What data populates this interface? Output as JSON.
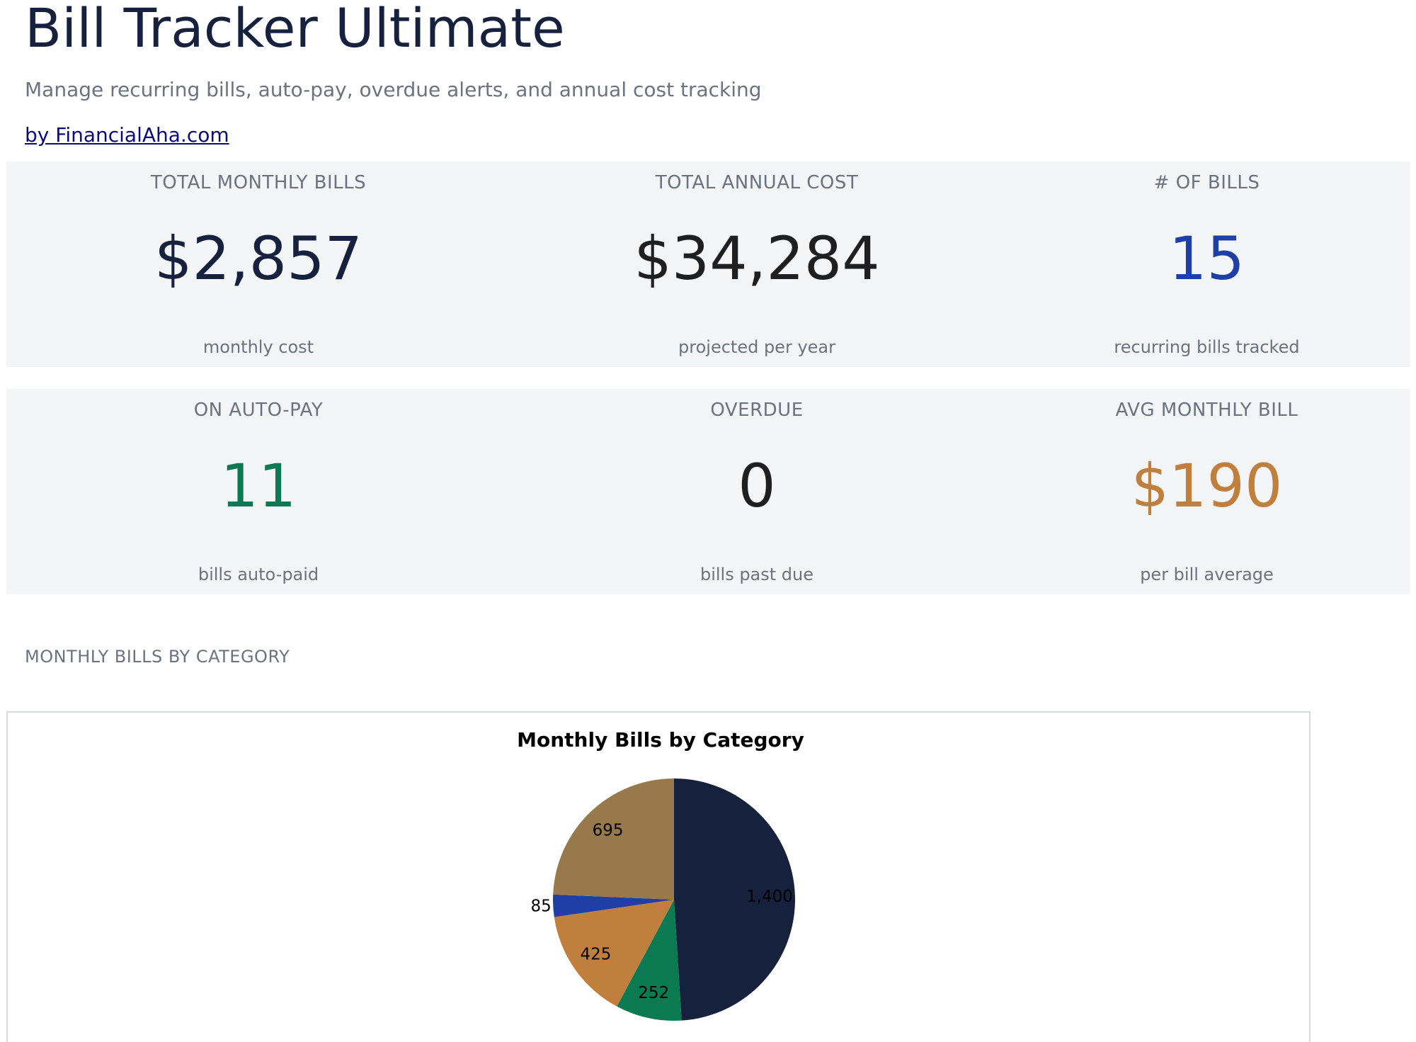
{
  "app": {
    "title": "Bill Tracker Ultimate",
    "subtitle": "Manage recurring bills, auto-pay, overdue alerts, and annual cost tracking",
    "byline": "by FinancialAha.com"
  },
  "kpis": {
    "row1": [
      {
        "label": "TOTAL MONTHLY BILLS",
        "value": "$2,857",
        "sub": "monthly cost",
        "color": "#16213d"
      },
      {
        "label": "TOTAL ANNUAL COST",
        "value": "$34,284",
        "sub": "projected per year",
        "color": "#1f1f1f"
      },
      {
        "label": "# OF BILLS",
        "value": "15",
        "sub": "recurring bills tracked",
        "color": "#1e3fa6"
      }
    ],
    "row2": [
      {
        "label": "ON AUTO-PAY",
        "value": "11",
        "sub": "bills auto-paid",
        "color": "#0b7a52"
      },
      {
        "label": "OVERDUE",
        "value": "0",
        "sub": "bills past due",
        "color": "#1f1f1f"
      },
      {
        "label": "AVG MONTHLY BILL",
        "value": "$190",
        "sub": "per bill average",
        "color": "#c17f3e"
      }
    ]
  },
  "section": {
    "title": "MONTHLY BILLS BY CATEGORY"
  },
  "chart_data": {
    "type": "pie",
    "title": "Monthly Bills by Category",
    "values": [
      1400,
      252,
      425,
      85,
      695
    ],
    "labels": [
      "1,400",
      "252",
      "425",
      "85",
      "695"
    ],
    "colors": [
      "#16213d",
      "#0b7a52",
      "#c17f3e",
      "#1e3fa6",
      "#97794c"
    ],
    "start": "12 o'clock",
    "direction": "clockwise",
    "legend": "none"
  }
}
